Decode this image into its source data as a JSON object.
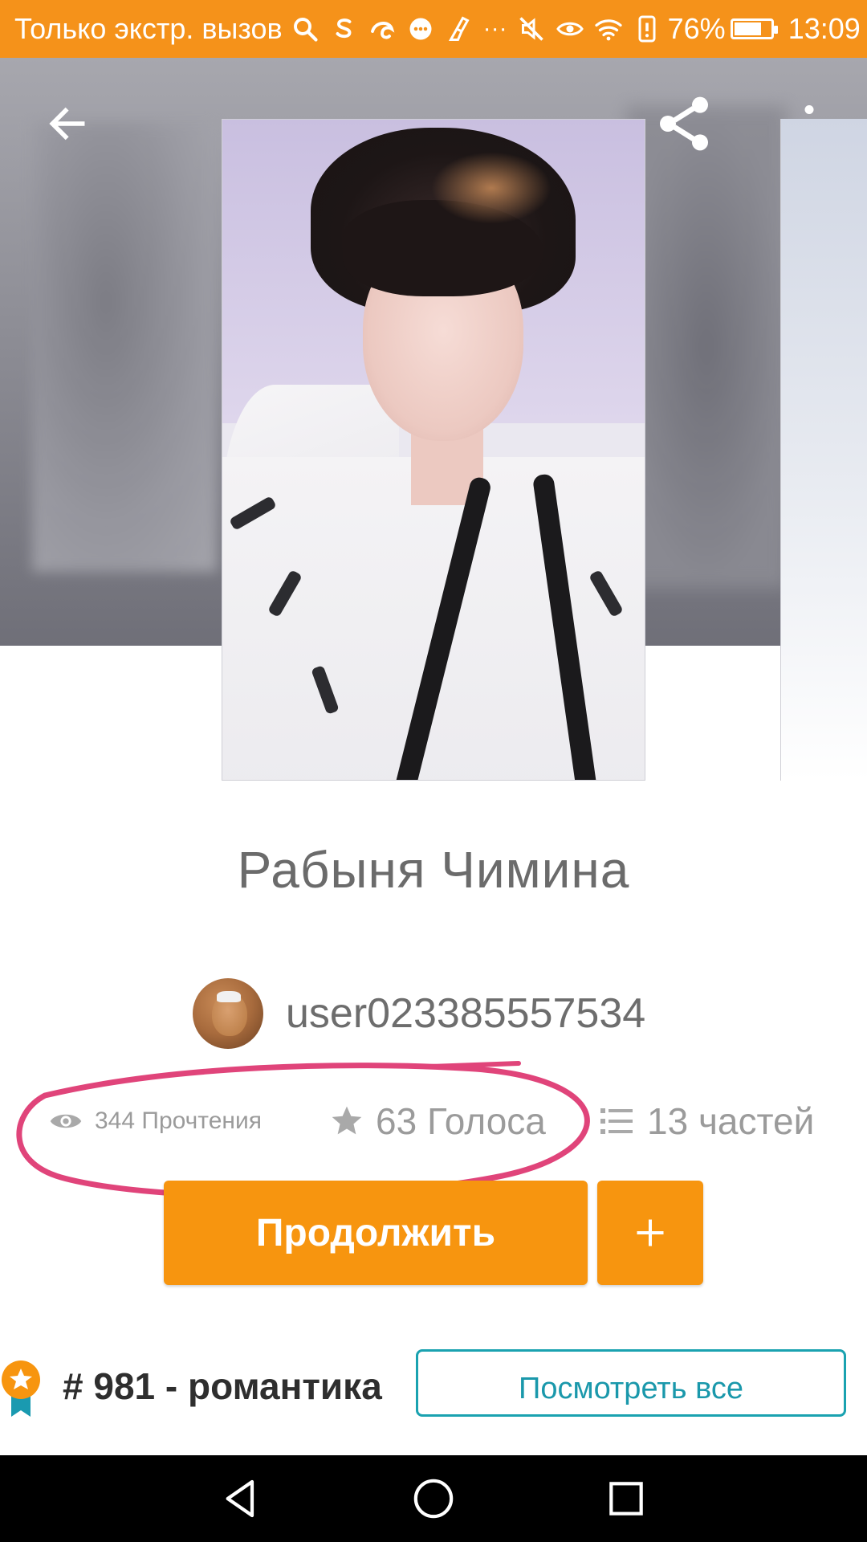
{
  "status_bar": {
    "carrier": "Только экстр. вызов",
    "battery": "76%",
    "time": "13:09",
    "overflow": "···"
  },
  "header": {
    "back_icon": "arrow-left-icon",
    "share_icon": "share-icon",
    "menu_icon": "more-vertical-icon"
  },
  "story": {
    "title": "Рабыня Чимина",
    "author": "user023385557534",
    "reads": "344 Прочтения",
    "votes": "63 Голоса",
    "parts": "13 частей"
  },
  "actions": {
    "continue_label": "Продолжить",
    "add_label": "+"
  },
  "ranking": {
    "text": "# 981 - романтика",
    "view_all_label": "Посмотреть все"
  },
  "colors": {
    "accent": "#f7950f",
    "status_bar": "#f5921a",
    "link": "#1aa2b0",
    "annotation": "#e0447a"
  }
}
